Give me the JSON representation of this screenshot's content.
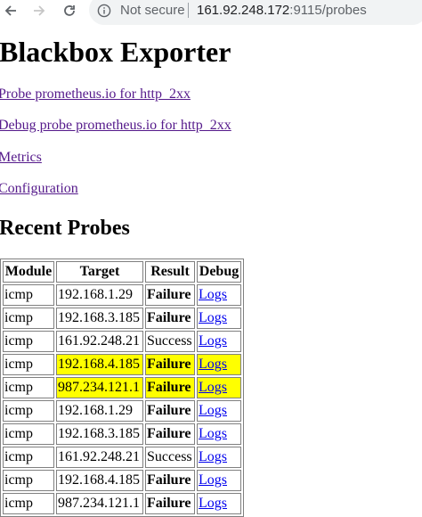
{
  "browser": {
    "security_label": "Not secure",
    "url_host": "161.92.248.172",
    "url_path": ":9115/probes"
  },
  "page": {
    "title": "Blackbox Exporter",
    "links": [
      "Probe prometheus.io for http_2xx",
      "Debug probe prometheus.io for http_2xx",
      "Metrics",
      "Configuration"
    ],
    "recent_probes_title": "Recent Probes"
  },
  "table": {
    "headers": [
      "Module",
      "Target",
      "Result",
      "Debug"
    ],
    "rows": [
      {
        "module": "icmp",
        "target": "192.168.1.29",
        "result": "Failure",
        "debug": "Logs",
        "highlighted": false
      },
      {
        "module": "icmp",
        "target": "192.168.3.185",
        "result": "Failure",
        "debug": "Logs",
        "highlighted": false
      },
      {
        "module": "icmp",
        "target": "161.92.248.21",
        "result": "Success",
        "debug": "Logs",
        "highlighted": false
      },
      {
        "module": "icmp",
        "target": "192.168.4.185",
        "result": "Failure",
        "debug": "Logs",
        "highlighted": true
      },
      {
        "module": "icmp",
        "target": "987.234.121.1",
        "result": "Failure",
        "debug": "Logs",
        "highlighted": true
      },
      {
        "module": "icmp",
        "target": "192.168.1.29",
        "result": "Failure",
        "debug": "Logs",
        "highlighted": false
      },
      {
        "module": "icmp",
        "target": "192.168.3.185",
        "result": "Failure",
        "debug": "Logs",
        "highlighted": false
      },
      {
        "module": "icmp",
        "target": "161.92.248.21",
        "result": "Success",
        "debug": "Logs",
        "highlighted": false
      },
      {
        "module": "icmp",
        "target": "192.168.4.185",
        "result": "Failure",
        "debug": "Logs",
        "highlighted": false
      },
      {
        "module": "icmp",
        "target": "987.234.121.1",
        "result": "Failure",
        "debug": "Logs",
        "highlighted": false
      }
    ]
  },
  "colors": {
    "highlight": "#ffff00",
    "visited_link": "#551a8b",
    "link": "#0000ee"
  },
  "icons": [
    "back-arrow-icon",
    "forward-arrow-icon",
    "reload-icon",
    "info-icon"
  ]
}
